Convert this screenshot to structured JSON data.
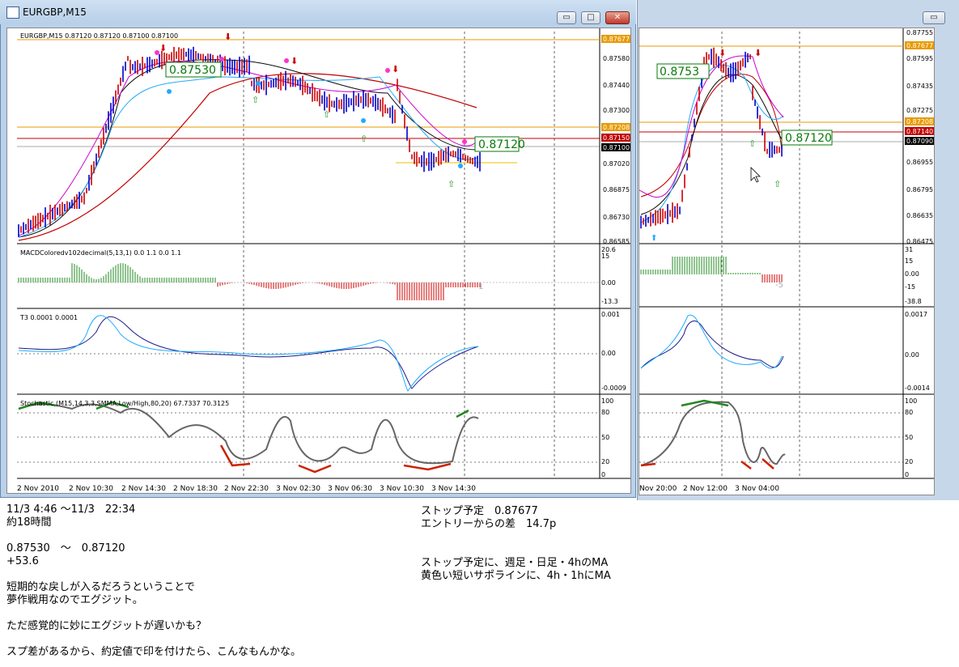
{
  "window": {
    "title": "EURGBP,M15",
    "btn_min": "▭",
    "btn_max": "□",
    "btn_close": "✕"
  },
  "colors": {
    "bull_candle": "#0000cc",
    "bear_candle": "#cc0000",
    "ma_slow": "#c00000",
    "ma_fast": "#0a0a0a",
    "ma_magenta": "#cc00cc",
    "envelope": "#22aaff",
    "stoch_red": "#cc2200",
    "stoch_green": "#228822",
    "level_orange": "#e89a00",
    "label_green": "#0a7a0a"
  },
  "main_chart": {
    "header": "EURGBP,M15  0.87120 0.87120 0.87100 0.87100",
    "price_ticks": [
      "0.87677",
      "0.87580",
      "0.87440",
      "0.87300",
      "0.87208",
      "0.87150",
      "0.87100",
      "0.87020",
      "0.86875",
      "0.86730",
      "0.86585"
    ],
    "entry_label": "0.87530",
    "exit_label": "0.87120",
    "macd_header": "MACDColoredv102decimal(5,13,1) 0.0 1.1 0.0 1.1",
    "macd_ticks": [
      "20.6",
      "15",
      "0.00",
      "-13.3"
    ],
    "macd_right_value": "1",
    "t3_header": "T3 0.0001 0.0001",
    "t3_ticks": [
      "0.001",
      "0.00",
      "-0.0009"
    ],
    "stoch_header": "Stochastic (M15,14,3,3,SMMA,Low/High,80,20) 67.7337 70.3125",
    "stoch_ticks": [
      "100",
      "80",
      "50",
      "20",
      "0"
    ],
    "time_labels": [
      "2 Nov 2010",
      "2 Nov 10:30",
      "2 Nov 14:30",
      "2 Nov 18:30",
      "2 Nov 22:30",
      "3 Nov 02:30",
      "3 Nov 06:30",
      "3 Nov 10:30",
      "3 Nov 14:30"
    ]
  },
  "right_chart": {
    "price_ticks": [
      "0.87755",
      "0.87677",
      "0.87595",
      "0.87435",
      "0.87275",
      "0.87208",
      "0.87140",
      "0.87090",
      "0.86955",
      "0.86795",
      "0.86635",
      "0.86475"
    ],
    "entry_label": "0.8753",
    "exit_label": "0.87120",
    "macd_ticks": [
      "31",
      "15",
      "0.00",
      "-15",
      "-38.8"
    ],
    "macd_right_value": "-5",
    "t3_ticks": [
      "0.0017",
      "0.00",
      "-0.0014"
    ],
    "stoch_ticks": [
      "100",
      "80",
      "50",
      "20",
      "0"
    ],
    "time_labels": [
      "Nov 20:00",
      "2 Nov 12:00",
      "3 Nov 04:00"
    ]
  },
  "notes_left": [
    "11/3 4:46 ～11/3　22:34",
    "約18時間",
    "",
    "0.87530　～　0.87120",
    "+53.6",
    "",
    "短期的な戻しが入るだろうということで",
    "夢作戦用なのでエグジット。",
    "",
    "ただ感覚的に妙にエグジットが遅いかも？",
    "",
    "スプ差があるから、約定値で印を付けたら、こんなもんかな。"
  ],
  "notes_right": [
    "ストップ予定　0.87677",
    "エントリーからの差　14.7p",
    "",
    "",
    "ストップ予定に、週足・日足・4hのMA",
    "黄色い短いサポラインに、4h・1hにMA"
  ]
}
